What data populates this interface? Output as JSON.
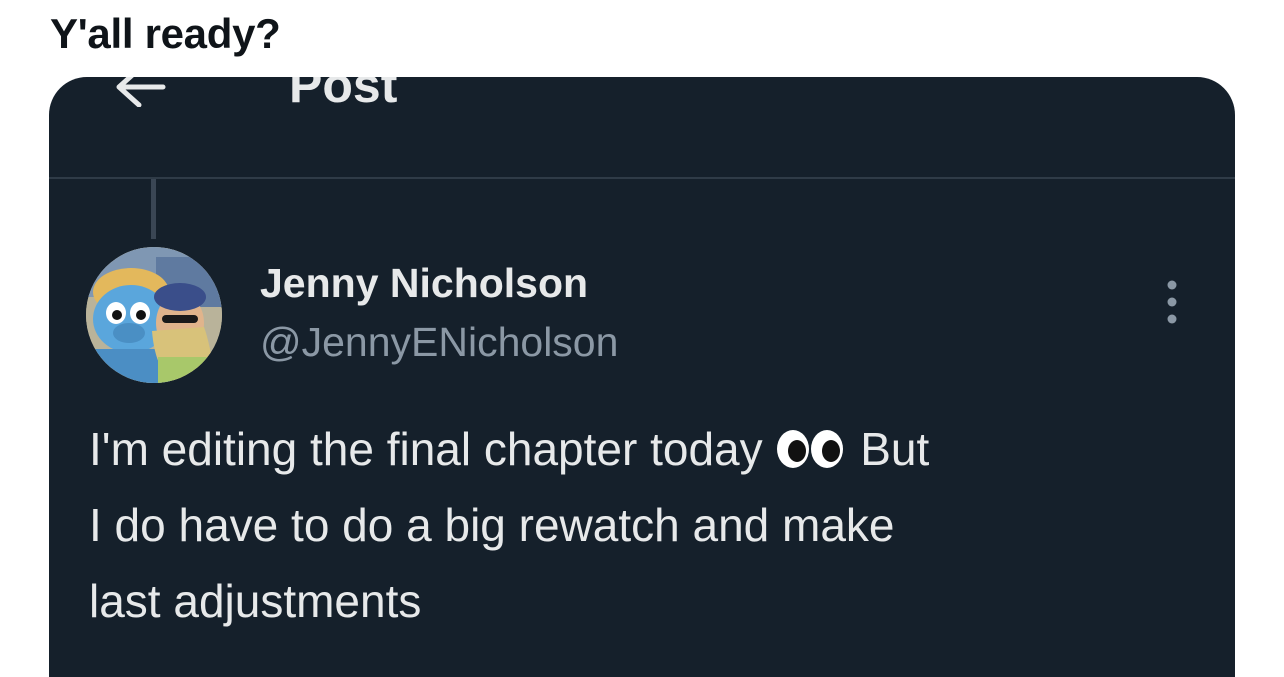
{
  "caption": "Y'all ready?",
  "header": {
    "title": "Post",
    "back_icon": "back-arrow-icon"
  },
  "post": {
    "author_name": "Jenny Nicholson",
    "author_handle": "@JennyENicholson",
    "more_icon": "more-vertical-icon",
    "text_line_1_before": "I'm editing the final chapter today",
    "text_line_1_emoji": "eyes-emoji",
    "text_line_1_after": "But",
    "text_line_2": "I do have to do a big rewatch and make",
    "text_line_3": "last adjustments"
  },
  "colors": {
    "card_background": "#15202b",
    "primary_text": "#e7e9ea",
    "secondary_text": "#8b98a5",
    "divider": "#2f3b47"
  }
}
